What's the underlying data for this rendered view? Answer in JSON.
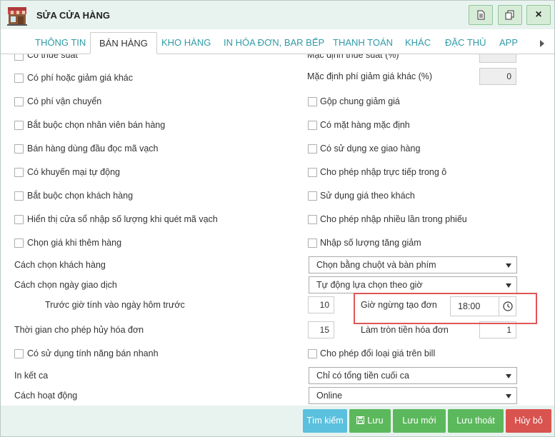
{
  "window": {
    "title": "SỬA CỬA HÀNG",
    "buttons": {
      "print_icon": "document-icon",
      "copy_icon": "copy-icon",
      "close_label": "×"
    }
  },
  "tabs": [
    {
      "label": "THÔNG TIN"
    },
    {
      "label": "BÁN HÀNG"
    },
    {
      "label": "KHO HÀNG"
    },
    {
      "label": "IN HÓA ĐƠN, BAR BẾP"
    },
    {
      "label": "THANH TOÁN"
    },
    {
      "label": "KHÁC"
    },
    {
      "label": "ĐẶC THÙ"
    },
    {
      "label": "APP"
    }
  ],
  "form": {
    "partial_top_left": "Có thuế suất",
    "partial_top_right": "Mặc định thuế suất (%)",
    "left_checks": [
      "Có phí hoặc giảm giá khác",
      "Có phí vận chuyển",
      "Bắt buộc chọn nhân viên bán hàng",
      "Bán hàng dùng đầu đọc mã vạch",
      "Có khuyến mại tự động",
      "Bắt buộc chọn khách hàng",
      "Hiển thị cửa sổ nhập số lượng khi quét mã vạch",
      "Chọn giá khi thêm hàng"
    ],
    "right_checks": [
      "Gộp chung giảm giá",
      "Có mặt hàng mặc định",
      "Có sử dụng xe giao hàng",
      "Cho phép nhập trực tiếp trong ô",
      "Sử dụng giá theo khách",
      "Cho phép nhập nhiều lần trong phiếu",
      "Nhập số lượng tăng giảm"
    ],
    "discount_default_label": "Mặc định phí giảm giá khác (%)",
    "discount_default_value": "0",
    "customer_select_label": "Cách chọn khách hàng",
    "customer_select_value": "Chọn bằng chuột và bàn phím",
    "trans_date_label": "Cách chọn ngày giao dịch",
    "trans_date_value": "Tự động lựa chọn theo giờ",
    "before_hour_label": "Trước giờ tính vào ngày hôm trước",
    "before_hour_value": "10",
    "stop_time_label": "Giờ ngừng tạo đơn",
    "stop_time_value": "18:00",
    "cancel_time_label": "Thời gian cho phép hủy hóa đơn",
    "cancel_time_value": "15",
    "round_label": "Làm tròn tiền hóa đơn",
    "round_value": "1",
    "quick_sale_label": "Có sử dụng tính năng bán nhanh",
    "change_price_label": "Cho phép đổi loại giá trên bill",
    "shift_print_label": "In kết ca",
    "shift_print_value": "Chỉ có tổng tiền cuối ca",
    "mode_label": "Cách hoạt động",
    "mode_value": "Online"
  },
  "footer": {
    "search": "Tìm kiếm",
    "save": "Lưu",
    "save_new": "Lưu mới",
    "save_exit": "Lưu thoát",
    "cancel": "Hủy bỏ"
  },
  "colors": {
    "tab_link": "#2f9aa6",
    "search_btn": "#5bc0de",
    "save_btn": "#5cb85c",
    "cancel_btn": "#d9534f",
    "highlight": "#e05555"
  }
}
